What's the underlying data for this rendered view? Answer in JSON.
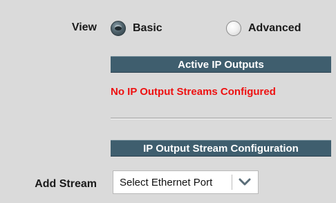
{
  "view": {
    "label": "View",
    "options": [
      {
        "label": "Basic",
        "selected": true
      },
      {
        "label": "Advanced",
        "selected": false
      }
    ]
  },
  "active_outputs": {
    "header": "Active IP Outputs",
    "status_text": "No IP Output Streams Configured"
  },
  "config": {
    "header": "IP Output Stream Configuration",
    "add_stream_label": "Add Stream",
    "select_value": "Select Ethernet Port"
  },
  "colors": {
    "bar_bg": "#3f5e6e",
    "status_text": "#ee1111",
    "page_bg": "#dadada"
  },
  "icons": {
    "dropdown": "chevron-down-icon"
  }
}
